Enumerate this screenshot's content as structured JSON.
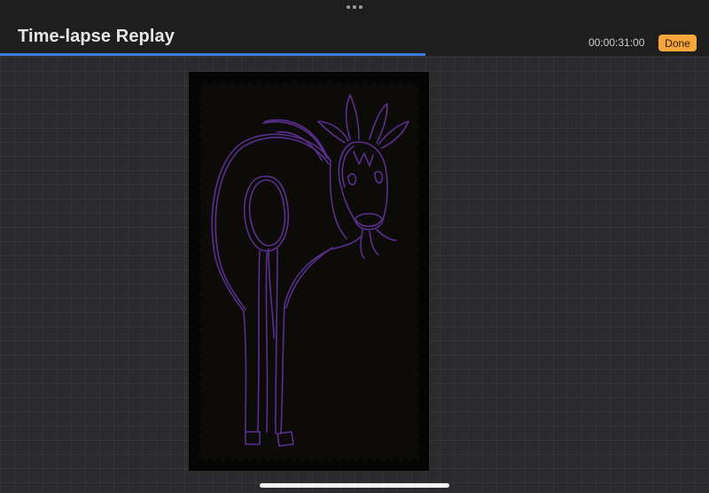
{
  "header": {
    "title": "Time-lapse Replay",
    "timer": "00:00:31:00",
    "done_label": "Done"
  },
  "playback": {
    "progress_fraction": 0.6
  },
  "colors": {
    "accent": "#3b7ddd",
    "done_button": "#f6a63b",
    "stroke": "#5a2f91",
    "canvas": "#0d0b07"
  },
  "icons": {
    "more": "more-dots-icon"
  }
}
